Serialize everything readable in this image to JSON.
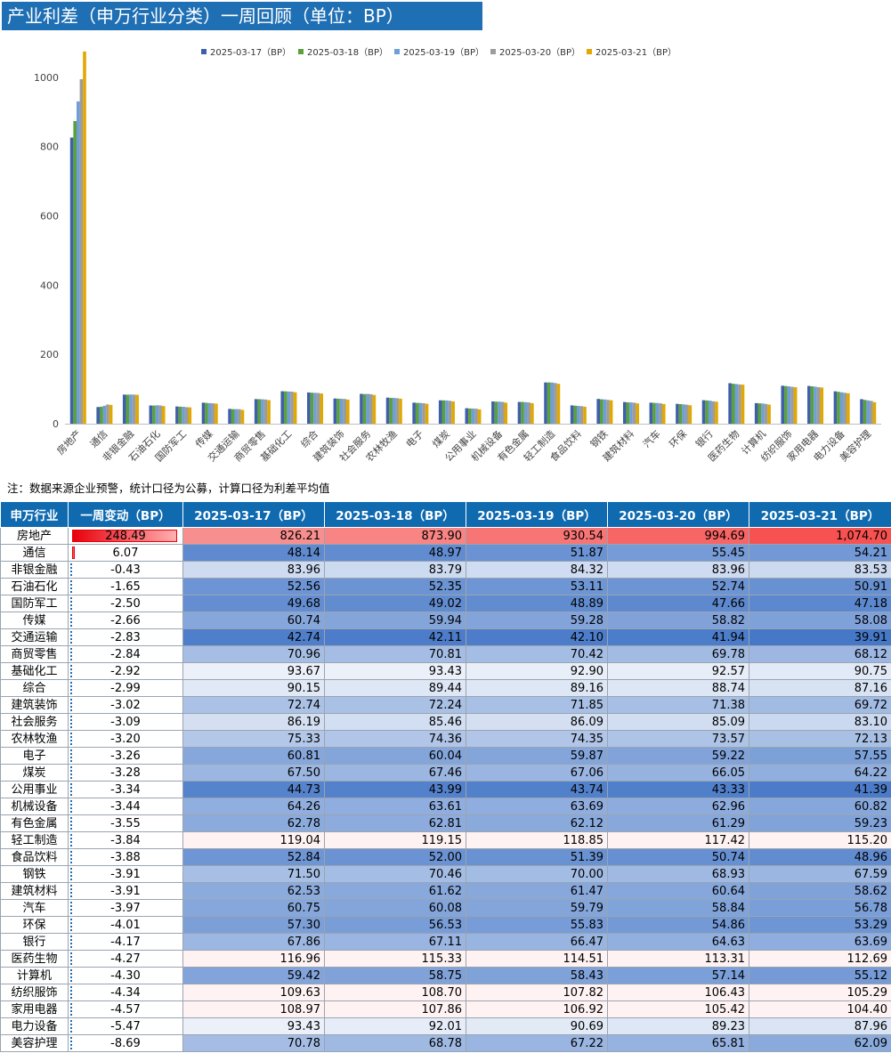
{
  "title": "产业利差（申万行业分类）一周回顾（单位：BP）",
  "note": "注：数据来源企业预警，统计口径为公募，计算口径为利差平均值",
  "colors": {
    "header_bg": "#0f6ab0",
    "s1": "#3f5fa8",
    "s2": "#5aa03c",
    "s3": "#6f9fd8",
    "s4": "#9c9c9c",
    "s5": "#e0a800"
  },
  "table": {
    "headers": [
      "申万行业",
      "一周变动（BP）",
      "2025-03-17（BP）",
      "2025-03-18（BP）",
      "2025-03-19（BP）",
      "2025-03-20（BP）",
      "2025-03-21（BP）"
    ],
    "rows": [
      {
        "name": "房地产",
        "chg": "248.49",
        "v": [
          "826.21",
          "873.90",
          "930.54",
          "994.69",
          "1,074.70"
        ]
      },
      {
        "name": "通信",
        "chg": "6.07",
        "v": [
          "48.14",
          "48.97",
          "51.87",
          "55.45",
          "54.21"
        ]
      },
      {
        "name": "非银金融",
        "chg": "-0.43",
        "v": [
          "83.96",
          "83.79",
          "84.32",
          "83.96",
          "83.53"
        ]
      },
      {
        "name": "石油石化",
        "chg": "-1.65",
        "v": [
          "52.56",
          "52.35",
          "53.11",
          "52.74",
          "50.91"
        ]
      },
      {
        "name": "国防军工",
        "chg": "-2.50",
        "v": [
          "49.68",
          "49.02",
          "48.89",
          "47.66",
          "47.18"
        ]
      },
      {
        "name": "传媒",
        "chg": "-2.66",
        "v": [
          "60.74",
          "59.94",
          "59.28",
          "58.82",
          "58.08"
        ]
      },
      {
        "name": "交通运输",
        "chg": "-2.83",
        "v": [
          "42.74",
          "42.11",
          "42.10",
          "41.94",
          "39.91"
        ]
      },
      {
        "name": "商贸零售",
        "chg": "-2.84",
        "v": [
          "70.96",
          "70.81",
          "70.42",
          "69.78",
          "68.12"
        ]
      },
      {
        "name": "基础化工",
        "chg": "-2.92",
        "v": [
          "93.67",
          "93.43",
          "92.90",
          "92.57",
          "90.75"
        ]
      },
      {
        "name": "综合",
        "chg": "-2.99",
        "v": [
          "90.15",
          "89.44",
          "89.16",
          "88.74",
          "87.16"
        ]
      },
      {
        "name": "建筑装饰",
        "chg": "-3.02",
        "v": [
          "72.74",
          "72.24",
          "71.85",
          "71.38",
          "69.72"
        ]
      },
      {
        "name": "社会服务",
        "chg": "-3.09",
        "v": [
          "86.19",
          "85.46",
          "86.09",
          "85.09",
          "83.10"
        ]
      },
      {
        "name": "农林牧渔",
        "chg": "-3.20",
        "v": [
          "75.33",
          "74.36",
          "74.35",
          "73.57",
          "72.13"
        ]
      },
      {
        "name": "电子",
        "chg": "-3.26",
        "v": [
          "60.81",
          "60.04",
          "59.87",
          "59.22",
          "57.55"
        ]
      },
      {
        "name": "煤炭",
        "chg": "-3.28",
        "v": [
          "67.50",
          "67.46",
          "67.06",
          "66.05",
          "64.22"
        ]
      },
      {
        "name": "公用事业",
        "chg": "-3.34",
        "v": [
          "44.73",
          "43.99",
          "43.74",
          "43.33",
          "41.39"
        ]
      },
      {
        "name": "机械设备",
        "chg": "-3.44",
        "v": [
          "64.26",
          "63.61",
          "63.69",
          "62.96",
          "60.82"
        ]
      },
      {
        "name": "有色金属",
        "chg": "-3.55",
        "v": [
          "62.78",
          "62.81",
          "62.12",
          "61.29",
          "59.23"
        ]
      },
      {
        "name": "轻工制造",
        "chg": "-3.84",
        "v": [
          "119.04",
          "119.15",
          "118.85",
          "117.42",
          "115.20"
        ]
      },
      {
        "name": "食品饮料",
        "chg": "-3.88",
        "v": [
          "52.84",
          "52.00",
          "51.39",
          "50.74",
          "48.96"
        ]
      },
      {
        "name": "钢铁",
        "chg": "-3.91",
        "v": [
          "71.50",
          "70.46",
          "70.00",
          "68.93",
          "67.59"
        ]
      },
      {
        "name": "建筑材料",
        "chg": "-3.91",
        "v": [
          "62.53",
          "61.62",
          "61.47",
          "60.64",
          "58.62"
        ]
      },
      {
        "name": "汽车",
        "chg": "-3.97",
        "v": [
          "60.75",
          "60.08",
          "59.79",
          "58.84",
          "56.78"
        ]
      },
      {
        "name": "环保",
        "chg": "-4.01",
        "v": [
          "57.30",
          "56.53",
          "55.83",
          "54.86",
          "53.29"
        ]
      },
      {
        "name": "银行",
        "chg": "-4.17",
        "v": [
          "67.86",
          "67.11",
          "66.47",
          "64.63",
          "63.69"
        ]
      },
      {
        "name": "医药生物",
        "chg": "-4.27",
        "v": [
          "116.96",
          "115.33",
          "114.51",
          "113.31",
          "112.69"
        ]
      },
      {
        "name": "计算机",
        "chg": "-4.30",
        "v": [
          "59.42",
          "58.75",
          "58.43",
          "57.14",
          "55.12"
        ]
      },
      {
        "name": "纺织服饰",
        "chg": "-4.34",
        "v": [
          "109.63",
          "108.70",
          "107.82",
          "106.43",
          "105.29"
        ]
      },
      {
        "name": "家用电器",
        "chg": "-4.57",
        "v": [
          "108.97",
          "107.86",
          "106.92",
          "105.42",
          "104.40"
        ]
      },
      {
        "name": "电力设备",
        "chg": "-5.47",
        "v": [
          "93.43",
          "92.01",
          "90.69",
          "89.23",
          "87.96"
        ]
      },
      {
        "name": "美容护理",
        "chg": "-8.69",
        "v": [
          "70.78",
          "68.78",
          "67.22",
          "65.81",
          "62.09"
        ]
      }
    ]
  },
  "chart_data": {
    "type": "bar",
    "title": "",
    "xlabel": "",
    "ylabel": "",
    "ylim": [
      0,
      1100
    ],
    "yticks": [
      0,
      200,
      400,
      600,
      800,
      1000
    ],
    "grid": false,
    "legend_position": "top",
    "categories": [
      "房地产",
      "通信",
      "非银金融",
      "石油石化",
      "国防军工",
      "传媒",
      "交通运输",
      "商贸零售",
      "基础化工",
      "综合",
      "建筑装饰",
      "社会服务",
      "农林牧渔",
      "电子",
      "煤炭",
      "公用事业",
      "机械设备",
      "有色金属",
      "轻工制造",
      "食品饮料",
      "钢铁",
      "建筑材料",
      "汽车",
      "环保",
      "银行",
      "医药生物",
      "计算机",
      "纺织服饰",
      "家用电器",
      "电力设备",
      "美容护理"
    ],
    "series": [
      {
        "name": "2025-03-17（BP）",
        "color": "#3f5fa8",
        "values": [
          826.21,
          48.14,
          83.96,
          52.56,
          49.68,
          60.74,
          42.74,
          70.96,
          93.67,
          90.15,
          72.74,
          86.19,
          75.33,
          60.81,
          67.5,
          44.73,
          64.26,
          62.78,
          119.04,
          52.84,
          71.5,
          62.53,
          60.75,
          57.3,
          67.86,
          116.96,
          59.42,
          109.63,
          108.97,
          93.43,
          70.78
        ]
      },
      {
        "name": "2025-03-18（BP）",
        "color": "#5aa03c",
        "values": [
          873.9,
          48.97,
          83.79,
          52.35,
          49.02,
          59.94,
          42.11,
          70.81,
          93.43,
          89.44,
          72.24,
          85.46,
          74.36,
          60.04,
          67.46,
          43.99,
          63.61,
          62.81,
          119.15,
          52.0,
          70.46,
          61.62,
          60.08,
          56.53,
          67.11,
          115.33,
          58.75,
          108.7,
          107.86,
          92.01,
          68.78
        ]
      },
      {
        "name": "2025-03-19（BP）",
        "color": "#6f9fd8",
        "values": [
          930.54,
          51.87,
          84.32,
          53.11,
          48.89,
          59.28,
          42.1,
          70.42,
          92.9,
          89.16,
          71.85,
          86.09,
          74.35,
          59.87,
          67.06,
          43.74,
          63.69,
          62.12,
          118.85,
          51.39,
          70.0,
          61.47,
          59.79,
          55.83,
          66.47,
          114.51,
          58.43,
          107.82,
          106.92,
          90.69,
          67.22
        ]
      },
      {
        "name": "2025-03-20（BP）",
        "color": "#9c9c9c",
        "values": [
          994.69,
          55.45,
          83.96,
          52.74,
          47.66,
          58.82,
          41.94,
          69.78,
          92.57,
          88.74,
          71.38,
          85.09,
          73.57,
          59.22,
          66.05,
          43.33,
          62.96,
          61.29,
          117.42,
          50.74,
          68.93,
          60.64,
          58.84,
          54.86,
          64.63,
          113.31,
          57.14,
          106.43,
          105.42,
          89.23,
          65.81
        ]
      },
      {
        "name": "2025-03-21（BP）",
        "color": "#e0a800",
        "values": [
          1074.7,
          54.21,
          83.53,
          50.91,
          47.18,
          58.08,
          39.91,
          68.12,
          90.75,
          87.16,
          69.72,
          83.1,
          72.13,
          57.55,
          64.22,
          41.39,
          60.82,
          59.23,
          115.2,
          48.96,
          67.59,
          58.62,
          56.78,
          53.29,
          63.69,
          112.69,
          55.12,
          105.29,
          104.4,
          87.96,
          62.09
        ]
      }
    ]
  }
}
